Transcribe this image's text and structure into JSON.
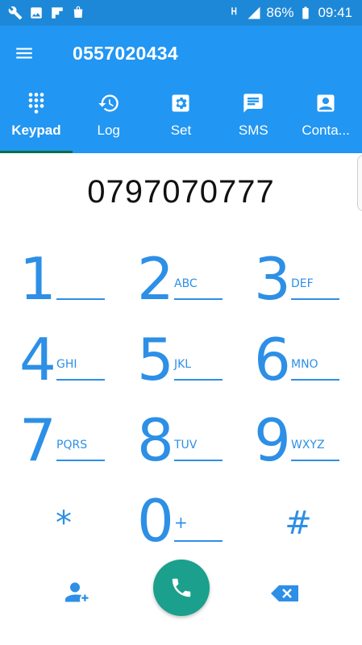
{
  "status_bar": {
    "battery_percent": "86%",
    "time": "09:41",
    "icons": [
      "wrench-icon",
      "image-icon",
      "flipboard-icon",
      "store-icon",
      "hd-voice-icon",
      "signal-icon",
      "battery-icon"
    ]
  },
  "app_bar": {
    "title": "0557020434",
    "menu_icon": "hamburger-menu-icon"
  },
  "tabs": [
    {
      "label": "Keypad",
      "icon": "dialpad-icon",
      "active": true
    },
    {
      "label": "Log",
      "icon": "history-icon",
      "active": false
    },
    {
      "label": "Set",
      "icon": "settings-icon",
      "active": false
    },
    {
      "label": "SMS",
      "icon": "message-icon",
      "active": false
    },
    {
      "label": "Conta...",
      "icon": "contact-icon",
      "active": false
    }
  ],
  "dialed_number": "0797070777",
  "keypad": {
    "keys": [
      {
        "digit": "1",
        "letters": ""
      },
      {
        "digit": "2",
        "letters": "ABC"
      },
      {
        "digit": "3",
        "letters": "DEF"
      },
      {
        "digit": "4",
        "letters": "GHI"
      },
      {
        "digit": "5",
        "letters": "JKL"
      },
      {
        "digit": "6",
        "letters": "MNO"
      },
      {
        "digit": "7",
        "letters": "PQRS"
      },
      {
        "digit": "8",
        "letters": "TUV"
      },
      {
        "digit": "9",
        "letters": "WXYZ"
      },
      {
        "digit": "*",
        "letters": ""
      },
      {
        "digit": "0",
        "letters": "+"
      },
      {
        "digit": "#",
        "letters": ""
      }
    ]
  },
  "actions": {
    "add_contact_icon": "add-contact-icon",
    "call_icon": "phone-icon",
    "backspace_icon": "backspace-icon"
  },
  "colors": {
    "app_bar": "#2196f3",
    "status_bar": "#1e88d8",
    "key_blue": "#2d8fe6",
    "call_green": "#1aa08c",
    "active_tab_indicator": "#0a6e4a"
  }
}
